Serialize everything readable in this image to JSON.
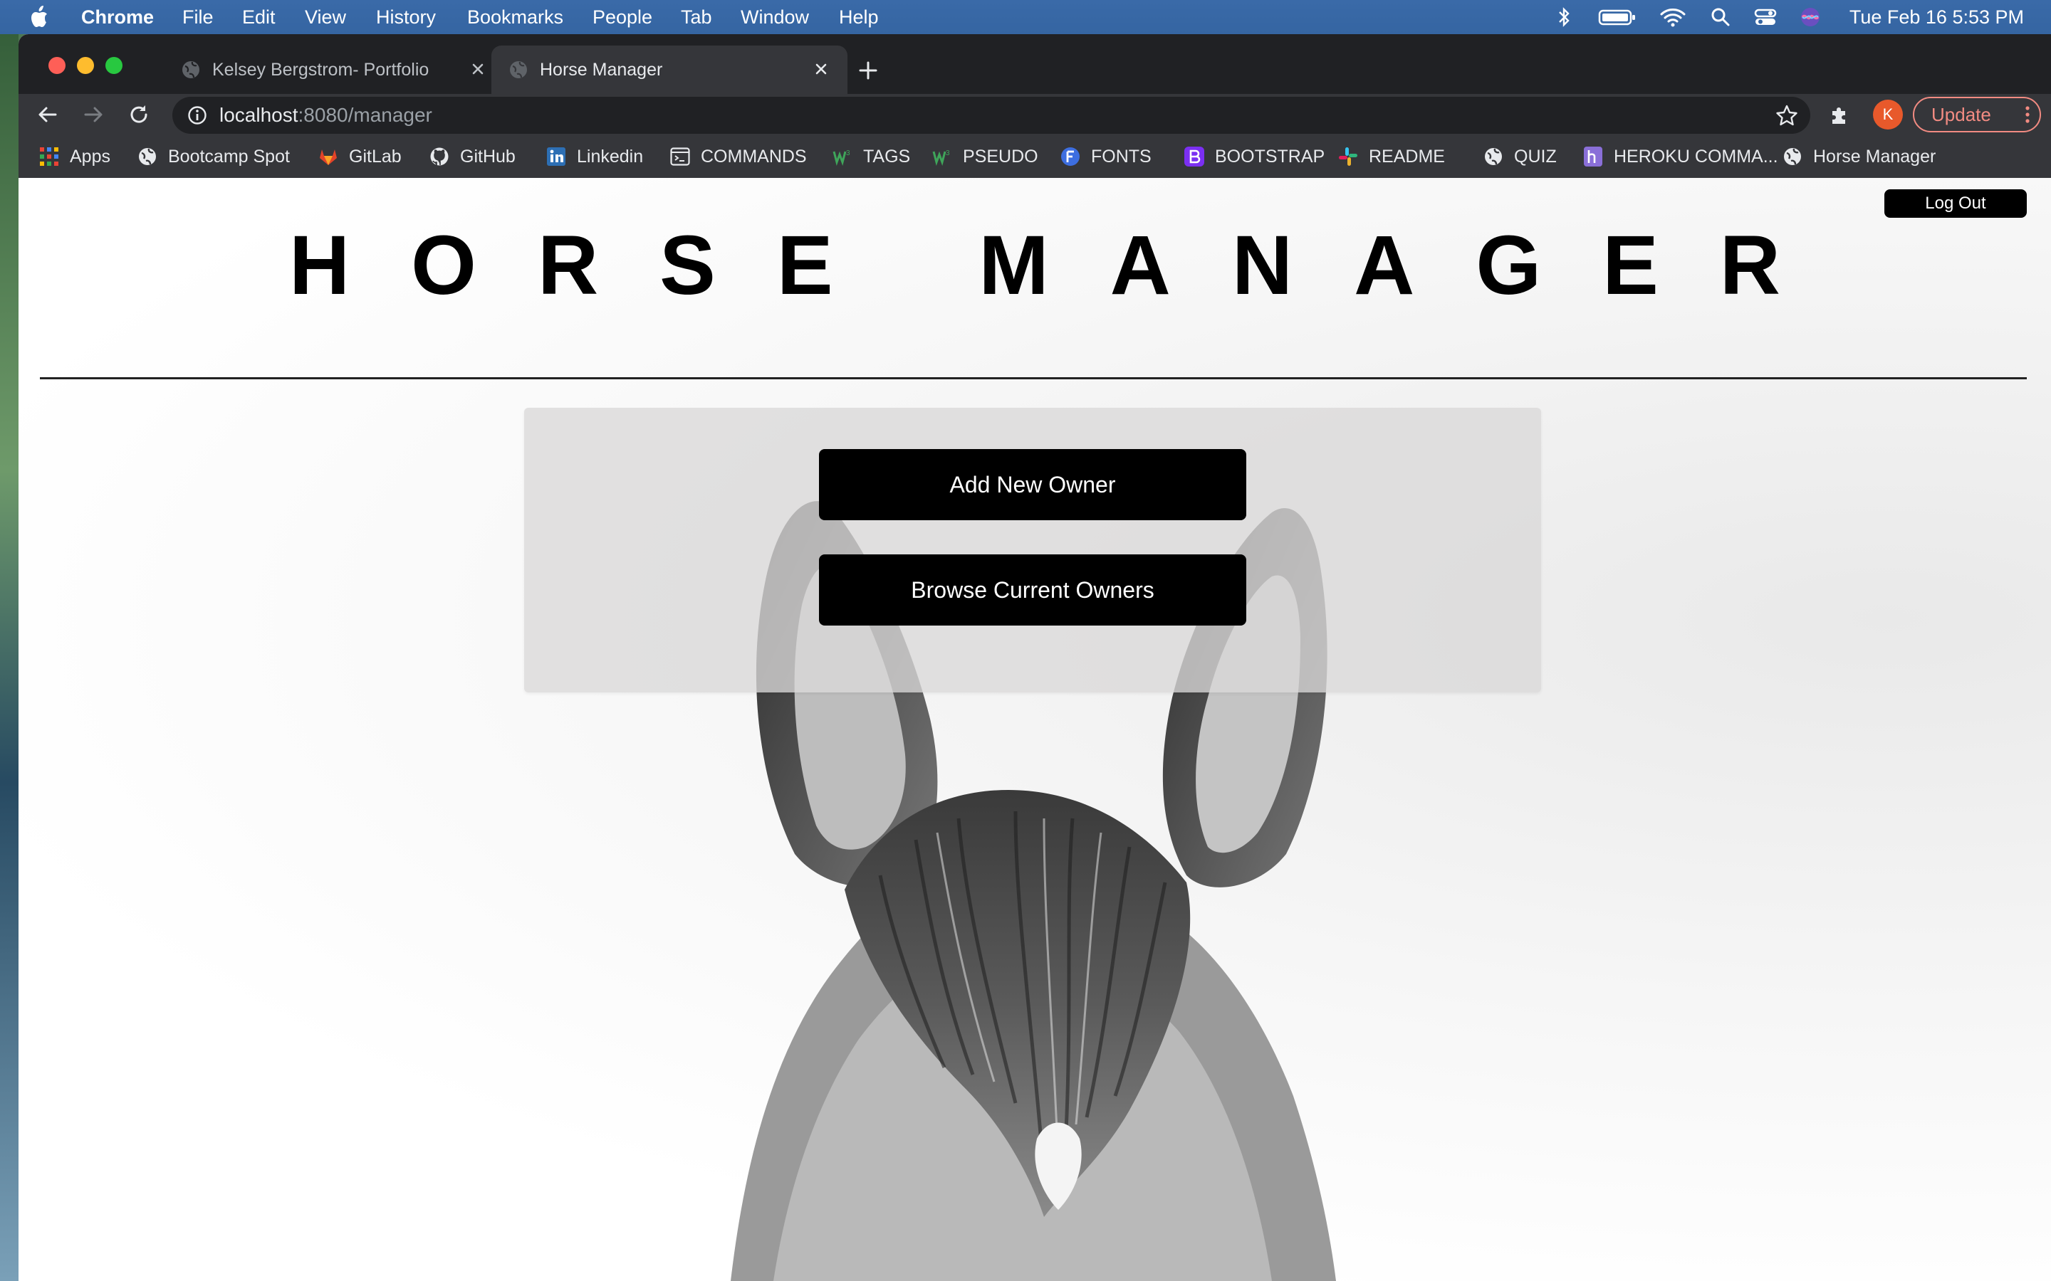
{
  "menubar": {
    "app_name": "Chrome",
    "menus": [
      "File",
      "Edit",
      "View",
      "History",
      "Bookmarks",
      "People",
      "Tab",
      "Window",
      "Help"
    ],
    "clock": "Tue Feb 16  5:53 PM"
  },
  "browser": {
    "tabs": [
      {
        "title": "Kelsey Bergstrom- Portfolio",
        "active": false
      },
      {
        "title": "Horse Manager",
        "active": true
      }
    ],
    "url": {
      "host": "localhost",
      "path": ":8080/manager"
    },
    "profile_initial": "K",
    "update_label": "Update",
    "bookmarks": [
      {
        "label": "Apps",
        "icon": "apps-grid-icon"
      },
      {
        "label": "Bootcamp Spot",
        "icon": "globe-icon"
      },
      {
        "label": "GitLab",
        "icon": "gitlab-icon"
      },
      {
        "label": "GitHub",
        "icon": "github-icon"
      },
      {
        "label": "Linkedin",
        "icon": "linkedin-icon"
      },
      {
        "label": "COMMANDS",
        "icon": "terminal-icon"
      },
      {
        "label": "TAGS",
        "icon": "w3schools-icon"
      },
      {
        "label": "PSEUDO",
        "icon": "w3schools-icon"
      },
      {
        "label": "FONTS",
        "icon": "fonts-icon"
      },
      {
        "label": "BOOTSTRAP",
        "icon": "bootstrap-icon"
      },
      {
        "label": "README",
        "icon": "slack-icon"
      },
      {
        "label": "QUIZ",
        "icon": "globe-icon"
      },
      {
        "label": "HEROKU COMMA...",
        "icon": "heroku-icon"
      },
      {
        "label": "Horse Manager",
        "icon": "globe-icon"
      }
    ]
  },
  "page": {
    "logout_label": "Log Out",
    "title": "HORSE MANAGER",
    "actions": {
      "add_owner": "Add New Owner",
      "browse_owners": "Browse Current Owners"
    }
  },
  "colors": {
    "accent": "#000000",
    "panel": "#dad8d9",
    "update": "#f28b82",
    "avatar": "#e8592b"
  }
}
